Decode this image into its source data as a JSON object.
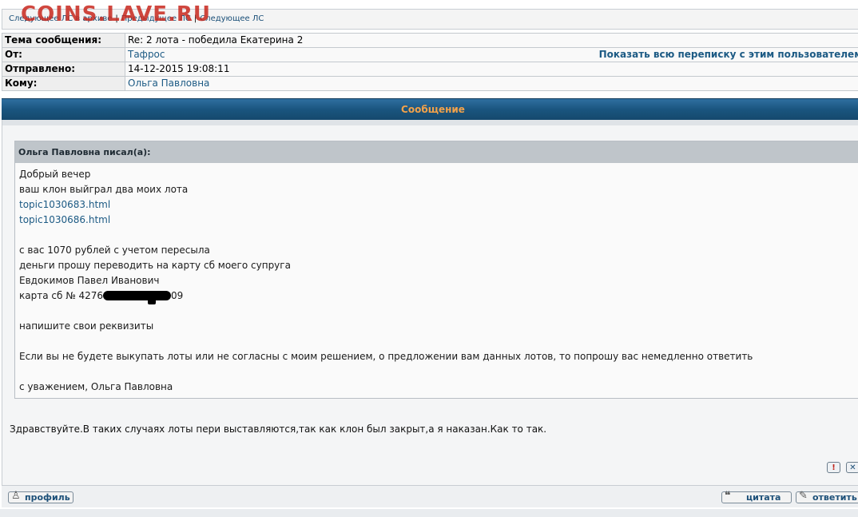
{
  "watermark": "COINS.LAVE.RU",
  "nav": {
    "next_archive": "Следующее ЛС в архиве",
    "previous": "Предыдущее ЛС",
    "next": "Следующее ЛС",
    "sep": "|"
  },
  "header": {
    "subject_label": "Тема сообщения:",
    "subject_value": "Re: 2 лота - победила Екатерина 2",
    "from_label": "От:",
    "from_value": "Тафрос",
    "show_all_link": "Показать всю переписку с этим пользователем",
    "sent_label": "Отправлено:",
    "sent_value": "14-12-2015 19:08:11",
    "to_label": "Кому:",
    "to_value": "Ольга Павловна"
  },
  "message": {
    "bar_title": "Сообщение",
    "quote_author": "Ольга Павловна писал(а):",
    "quote_lines": {
      "l1": "Добрый вечер",
      "l2": "ваш клон выйграл два моих лота",
      "link1": "topic1030683.html",
      "link2": "topic1030686.html",
      "l3": "с вас 1070 рублей с учетом пересыла",
      "l4": "деньги прошу переводить на карту сб моего супруга",
      "l5": "Евдокимов Павел Иванович",
      "card_prefix": "карта сб № 4276",
      "card_suffix": "09",
      "l6": "напишите свои реквизиты",
      "l7": "Если вы не будете выкупать лоты или не согласны с моим решением, о предложении вам данных лотов, то попрошу вас немедленно ответить",
      "l8": "с уважением, Ольга Павловна"
    },
    "reply_text": "Здравствуйте.В таких случаях лоты пери выставляются,так как клон был закрыт,а я наказан.Как то так.",
    "report_icon_text": "!",
    "delete_icon_text": "✕"
  },
  "footer": {
    "profile_label": "профиль",
    "quote_label": "цитата",
    "reply_label": "ответить"
  }
}
